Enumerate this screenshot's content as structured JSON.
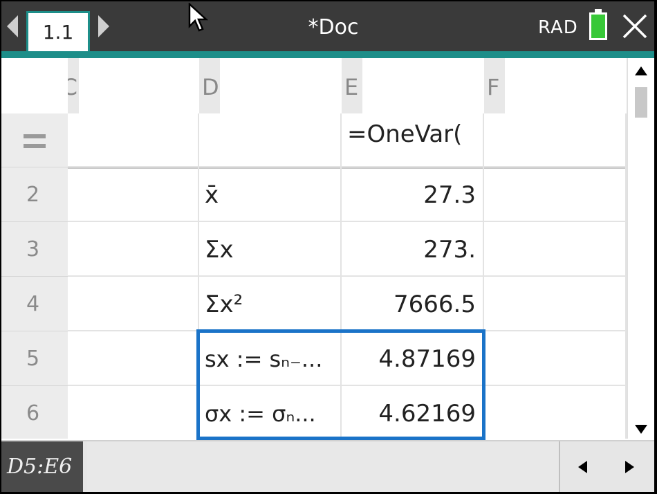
{
  "titlebar": {
    "tab_label": "1.1",
    "doc_title": "*Doc",
    "angle_mode": "RAD"
  },
  "columns": [
    {
      "letter": "C"
    },
    {
      "letter": "D"
    },
    {
      "letter": "E"
    },
    {
      "letter": "F"
    }
  ],
  "formula_row": {
    "symbol": "=",
    "e_formula": "=OneVar("
  },
  "rows": [
    {
      "num": "2",
      "d": "x̄",
      "e": "27.3"
    },
    {
      "num": "3",
      "d": "Σx",
      "e": "273."
    },
    {
      "num": "4",
      "d": "Σx²",
      "e": "7666.5"
    },
    {
      "num": "5",
      "d": "sx := sₙ₋...",
      "e": "4.87169"
    },
    {
      "num": "6",
      "d": "σx := σₙ...",
      "e": "4.62169"
    }
  ],
  "bottombar": {
    "cell_reference": "D5:E6"
  },
  "colors": {
    "accent": "#1d8e89",
    "selection": "#1a73c8",
    "battery": "#38c838"
  }
}
